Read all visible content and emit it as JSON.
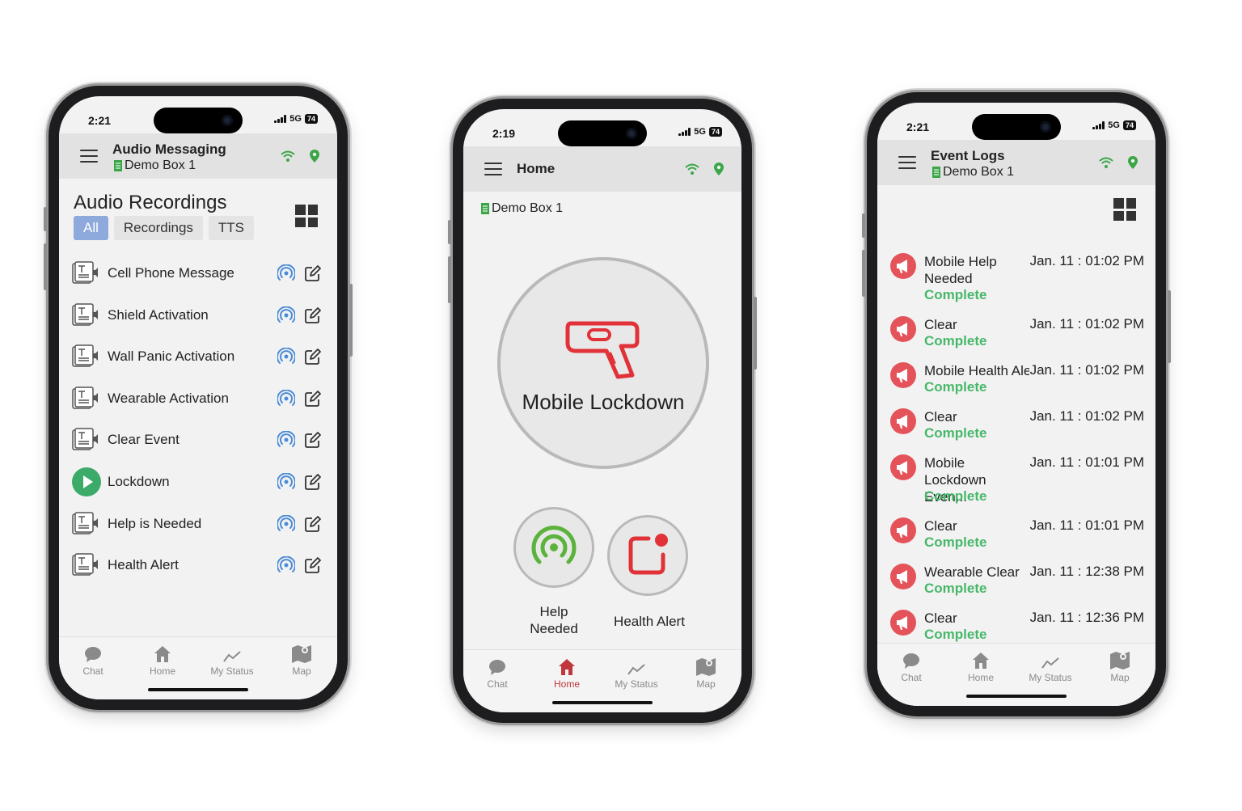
{
  "colors": {
    "accent_green": "#3aa648",
    "status_green": "#47b86a",
    "alert_red": "#e5535a",
    "tab_active": "#c0363a",
    "selected_chip": "#8ea9db",
    "ring_blue": "#4a8bd6"
  },
  "tabbar": {
    "chat": "Chat",
    "home": "Home",
    "my_status": "My Status",
    "map": "Map"
  },
  "phone1": {
    "time": "2:21",
    "network": "5G",
    "battery": "74",
    "title": "Audio Messaging",
    "location": "Demo Box 1",
    "section_title": "Audio Recordings",
    "filters": [
      "All",
      "Recordings",
      "TTS"
    ],
    "items": [
      {
        "label": "Cell Phone Message",
        "icon": "tts-icon"
      },
      {
        "label": "Shield Activation",
        "icon": "tts-icon"
      },
      {
        "label": "Wall Panic Activation",
        "icon": "tts-icon"
      },
      {
        "label": "Wearable Activation",
        "icon": "tts-icon"
      },
      {
        "label": "Clear Event",
        "icon": "tts-icon"
      },
      {
        "label": "Lockdown",
        "icon": "play-icon"
      },
      {
        "label": "Help is Needed",
        "icon": "tts-icon"
      },
      {
        "label": "Health Alert",
        "icon": "tts-icon"
      }
    ]
  },
  "phone2": {
    "time": "2:19",
    "network": "5G",
    "battery": "74",
    "title": "Home",
    "location": "Demo Box 1",
    "main_button": "Mobile Lockdown",
    "help_label": "Help Needed",
    "health_label": "Health Alert"
  },
  "phone3": {
    "time": "2:21",
    "network": "5G",
    "battery": "74",
    "title": "Event Logs",
    "location": "Demo Box 1",
    "events": [
      {
        "name": "Mobile Help Needed",
        "time": "Jan. 11 : 01:02 PM",
        "status": "Complete"
      },
      {
        "name": "Clear",
        "time": "Jan. 11 : 01:02 PM",
        "status": "Complete"
      },
      {
        "name": "Mobile Health Alert",
        "time": "Jan. 11 : 01:02 PM",
        "status": "Complete"
      },
      {
        "name": "Clear",
        "time": "Jan. 11 : 01:02 PM",
        "status": "Complete"
      },
      {
        "name": "Mobile Lockdown Even...",
        "time": "Jan. 11 : 01:01 PM",
        "status": "Complete"
      },
      {
        "name": "Clear",
        "time": "Jan. 11 : 01:01 PM",
        "status": "Complete"
      },
      {
        "name": "Wearable Clear",
        "time": "Jan. 11 : 12:38 PM",
        "status": "Complete"
      },
      {
        "name": "Clear",
        "time": "Jan. 11 : 12:36 PM",
        "status": "Complete"
      }
    ]
  }
}
